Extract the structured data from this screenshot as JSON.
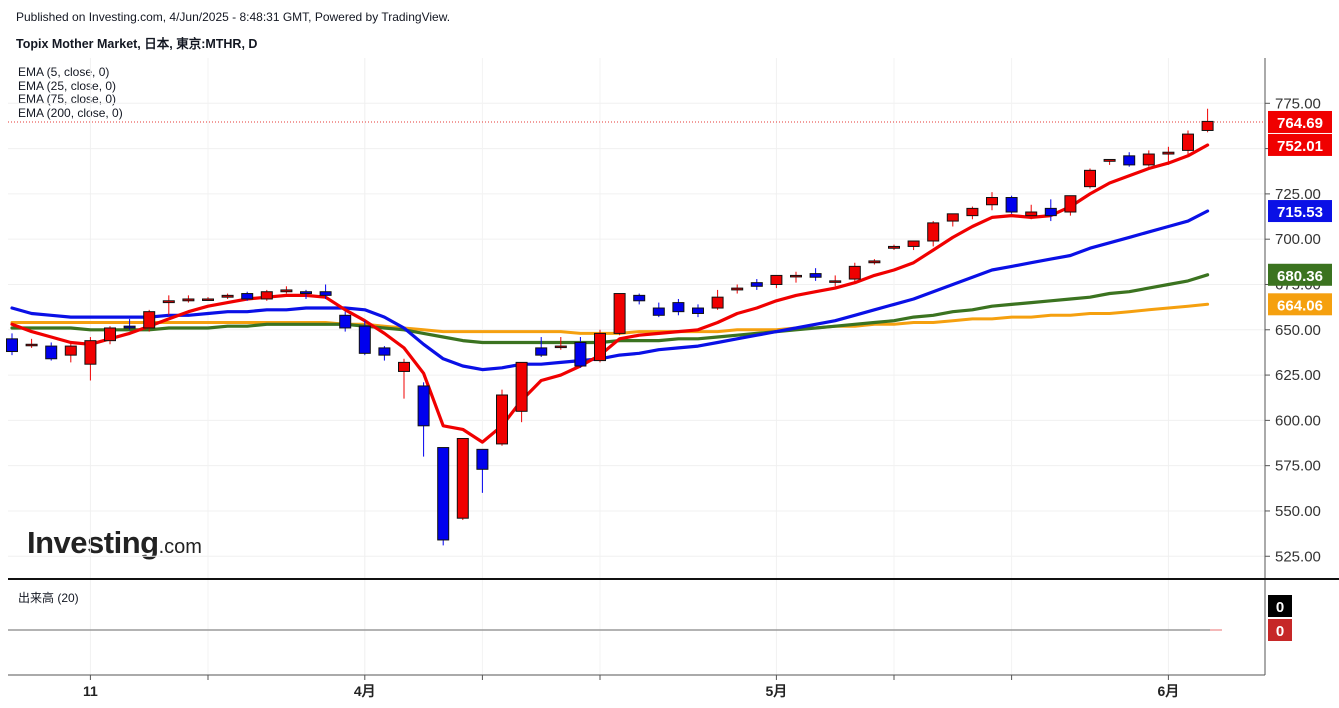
{
  "header": {
    "published": "Published on Investing.com, 4/Jun/2025 - 8:48:31 GMT, Powered by TradingView.",
    "symbol": "Topix Mother Market, 日本, 東京:MTHR, D"
  },
  "legend": [
    {
      "label": "EMA (5, close, 0)"
    },
    {
      "label": "EMA (25, close, 0)"
    },
    {
      "label": "EMA (75, close, 0)"
    },
    {
      "label": "EMA (200, close, 0)"
    }
  ],
  "volume": {
    "label": "出来高 (20)",
    "tags": [
      "0",
      "0"
    ]
  },
  "logo": {
    "main": "Investing",
    "suffix": ".com"
  },
  "colors": {
    "up": "#f00000",
    "down": "#0000ee",
    "ema5": "#f00000",
    "ema25": "#0a10e6",
    "ema75": "#3b7320",
    "ema200": "#f5a00f",
    "last_line": "#e53935"
  },
  "chart_data": {
    "type": "candlestick",
    "y_ticks": [
      525,
      550,
      575,
      600,
      625,
      650,
      675,
      700,
      725,
      750,
      775
    ],
    "y_tick_labels": [
      "525.00",
      "550.00",
      "575.00",
      "600.00",
      "625.00",
      "650.00",
      "675.00",
      "700.00",
      "725.00",
      "",
      "775.00"
    ],
    "ylim": [
      513,
      800
    ],
    "x_labels": [
      {
        "label": "11",
        "idx": 4
      },
      {
        "label": "4月",
        "idx": 18
      },
      {
        "label": "5月",
        "idx": 39
      },
      {
        "label": "6月",
        "idx": 59
      }
    ],
    "x_minor_ticks": [
      10,
      24,
      30,
      45,
      51
    ],
    "candles": [
      {
        "o": 645,
        "h": 648,
        "l": 636,
        "c": 638
      },
      {
        "o": 642,
        "h": 645,
        "l": 640,
        "c": 642
      },
      {
        "o": 641,
        "h": 643,
        "l": 633,
        "c": 634
      },
      {
        "o": 636,
        "h": 643,
        "l": 632,
        "c": 641
      },
      {
        "o": 631,
        "h": 646,
        "l": 622,
        "c": 644
      },
      {
        "o": 644,
        "h": 652,
        "l": 642,
        "c": 651
      },
      {
        "o": 652,
        "h": 656,
        "l": 650,
        "c": 651
      },
      {
        "o": 651,
        "h": 661,
        "l": 649,
        "c": 660
      },
      {
        "o": 665,
        "h": 669,
        "l": 658,
        "c": 666
      },
      {
        "o": 666,
        "h": 669,
        "l": 665,
        "c": 667
      },
      {
        "o": 667,
        "h": 668,
        "l": 666,
        "c": 667
      },
      {
        "o": 668,
        "h": 670,
        "l": 667,
        "c": 669
      },
      {
        "o": 670,
        "h": 671,
        "l": 666,
        "c": 667
      },
      {
        "o": 667,
        "h": 672,
        "l": 666,
        "c": 671
      },
      {
        "o": 671,
        "h": 674,
        "l": 670,
        "c": 672
      },
      {
        "o": 671,
        "h": 672,
        "l": 667,
        "c": 670
      },
      {
        "o": 671,
        "h": 675,
        "l": 667,
        "c": 669
      },
      {
        "o": 658,
        "h": 660,
        "l": 649,
        "c": 651
      },
      {
        "o": 652,
        "h": 655,
        "l": 636,
        "c": 637
      },
      {
        "o": 640,
        "h": 641,
        "l": 633,
        "c": 636
      },
      {
        "o": 627,
        "h": 634,
        "l": 612,
        "c": 632
      },
      {
        "o": 619,
        "h": 621,
        "l": 580,
        "c": 597
      },
      {
        "o": 585,
        "h": 585,
        "l": 531,
        "c": 534
      },
      {
        "o": 546,
        "h": 590,
        "l": 545,
        "c": 590
      },
      {
        "o": 584,
        "h": 584,
        "l": 560,
        "c": 573
      },
      {
        "o": 587,
        "h": 617,
        "l": 586,
        "c": 614
      },
      {
        "o": 605,
        "h": 632,
        "l": 599,
        "c": 632
      },
      {
        "o": 640,
        "h": 646,
        "l": 635,
        "c": 636
      },
      {
        "o": 641,
        "h": 646,
        "l": 639,
        "c": 641
      },
      {
        "o": 643,
        "h": 646,
        "l": 629,
        "c": 630
      },
      {
        "o": 633,
        "h": 650,
        "l": 632,
        "c": 648
      },
      {
        "o": 648,
        "h": 670,
        "l": 647,
        "c": 670
      },
      {
        "o": 669,
        "h": 670,
        "l": 664,
        "c": 666
      },
      {
        "o": 662,
        "h": 665,
        "l": 657,
        "c": 658
      },
      {
        "o": 665,
        "h": 667,
        "l": 658,
        "c": 660
      },
      {
        "o": 662,
        "h": 664,
        "l": 657,
        "c": 659
      },
      {
        "o": 662,
        "h": 672,
        "l": 661,
        "c": 668
      },
      {
        "o": 672,
        "h": 675,
        "l": 670,
        "c": 673
      },
      {
        "o": 676,
        "h": 678,
        "l": 672,
        "c": 674
      },
      {
        "o": 675,
        "h": 679,
        "l": 673,
        "c": 680
      },
      {
        "o": 680,
        "h": 682,
        "l": 676,
        "c": 680
      },
      {
        "o": 681,
        "h": 684,
        "l": 677,
        "c": 679
      },
      {
        "o": 677,
        "h": 680,
        "l": 674,
        "c": 677
      },
      {
        "o": 678,
        "h": 687,
        "l": 676,
        "c": 685
      },
      {
        "o": 687,
        "h": 689,
        "l": 686,
        "c": 688
      },
      {
        "o": 695,
        "h": 697,
        "l": 694,
        "c": 696
      },
      {
        "o": 696,
        "h": 699,
        "l": 694,
        "c": 699
      },
      {
        "o": 699,
        "h": 710,
        "l": 696,
        "c": 709
      },
      {
        "o": 710,
        "h": 712,
        "l": 707,
        "c": 714
      },
      {
        "o": 713,
        "h": 718,
        "l": 711,
        "c": 717
      },
      {
        "o": 719,
        "h": 726,
        "l": 716,
        "c": 723
      },
      {
        "o": 723,
        "h": 724,
        "l": 714,
        "c": 715
      },
      {
        "o": 713,
        "h": 719,
        "l": 711,
        "c": 715
      },
      {
        "o": 717,
        "h": 722,
        "l": 710,
        "c": 713
      },
      {
        "o": 715,
        "h": 722,
        "l": 713,
        "c": 724
      },
      {
        "o": 729,
        "h": 739,
        "l": 728,
        "c": 738
      },
      {
        "o": 743,
        "h": 744,
        "l": 741,
        "c": 744
      },
      {
        "o": 746,
        "h": 748,
        "l": 740,
        "c": 741
      },
      {
        "o": 741,
        "h": 749,
        "l": 740,
        "c": 747
      },
      {
        "o": 747,
        "h": 751,
        "l": 741,
        "c": 748
      },
      {
        "o": 749,
        "h": 760,
        "l": 747,
        "c": 758
      },
      {
        "o": 760,
        "h": 772,
        "l": 759,
        "c": 765
      }
    ],
    "ema5": [
      653,
      649,
      646,
      643,
      642,
      645,
      648,
      652,
      656,
      660,
      663,
      665,
      667,
      668,
      669,
      669,
      668,
      661,
      655,
      648,
      640,
      626,
      597,
      595,
      588,
      597,
      611,
      622,
      625,
      630,
      636,
      645,
      647,
      648,
      649,
      650,
      654,
      659,
      662,
      666,
      669,
      671,
      673,
      676,
      680,
      683,
      687,
      694,
      701,
      707,
      712,
      713,
      712,
      713,
      718,
      725,
      731,
      735,
      739,
      742,
      746,
      752
    ],
    "ema25": [
      662,
      659,
      658,
      657,
      657,
      657,
      657,
      657,
      658,
      658,
      659,
      660,
      660,
      661,
      661,
      662,
      662,
      662,
      661,
      657,
      651,
      642,
      634,
      630,
      628,
      629,
      631,
      631,
      632,
      633,
      634,
      636,
      637,
      639,
      640,
      641,
      643,
      645,
      647,
      649,
      651,
      653,
      655,
      658,
      661,
      664,
      667,
      671,
      675,
      679,
      683,
      685,
      687,
      689,
      691,
      695,
      698,
      701,
      704,
      707,
      710,
      715.53
    ],
    "ema75": [
      651,
      651,
      651,
      651,
      650,
      650,
      650,
      650,
      651,
      651,
      651,
      652,
      652,
      653,
      653,
      653,
      653,
      653,
      652,
      651,
      650,
      648,
      646,
      644,
      643,
      643,
      643,
      643,
      643,
      643,
      643,
      644,
      644,
      644,
      645,
      645,
      646,
      647,
      648,
      649,
      650,
      651,
      652,
      653,
      654,
      655,
      657,
      658,
      660,
      661,
      663,
      664,
      665,
      666,
      667,
      668,
      670,
      671,
      673,
      675,
      677,
      680.36
    ],
    "ema200": [
      654,
      654,
      654,
      654,
      654,
      654,
      654,
      654,
      654,
      654,
      654,
      654,
      654,
      654,
      654,
      654,
      654,
      653,
      653,
      652,
      651,
      650,
      649,
      649,
      649,
      649,
      649,
      649,
      649,
      648,
      648,
      648,
      649,
      649,
      649,
      649,
      649,
      650,
      650,
      650,
      651,
      651,
      652,
      652,
      653,
      653,
      654,
      654,
      655,
      656,
      656,
      657,
      657,
      658,
      658,
      659,
      659,
      660,
      661,
      662,
      663,
      664.06
    ],
    "price_tags": [
      {
        "value": 764.69,
        "label": "764.69",
        "color": "#f00000"
      },
      {
        "value": 752.01,
        "label": "752.01",
        "color": "#f00000"
      },
      {
        "value": 715.53,
        "label": "715.53",
        "color": "#0a10e6"
      },
      {
        "value": 680.36,
        "label": "680.36",
        "color": "#3b7320"
      },
      {
        "value": 664.06,
        "label": "664.06",
        "color": "#f5a00f"
      }
    ],
    "last_price": 764.69
  }
}
